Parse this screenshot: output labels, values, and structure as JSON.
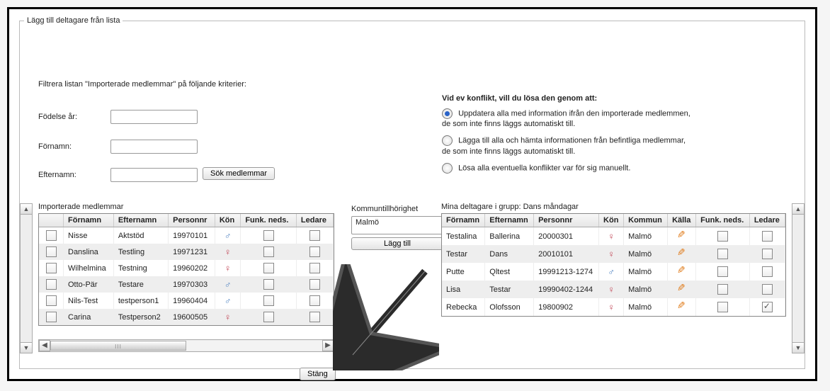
{
  "legend": "Lägg till deltagare från lista",
  "filter": {
    "intro": "Filtrera listan \"Importerade medlemmar\" på följande kriterier:",
    "birth_label": "Födelse år:",
    "first_label": "Förnamn:",
    "last_label": "Efternamn:",
    "birth_value": "",
    "first_value": "",
    "last_value": "",
    "search_btn": "Sök medlemmar"
  },
  "conflict": {
    "heading": "Vid ev konflikt, vill du lösa den genom att:",
    "opt1_a": "Uppdatera alla med information ifrån den importerade medlemmen,",
    "opt1_b": "de som inte finns läggs automatiskt till.",
    "opt2_a": "Lägga till alla och hämta informationen från befintliga medlemmar,",
    "opt2_b": "de som inte finns läggs automatiskt till.",
    "opt3": "Lösa alla eventuella konflikter var för sig manuellt."
  },
  "imported": {
    "title": "Importerade medlemmar",
    "headers": {
      "sel": "",
      "fn": "Förnamn",
      "en": "Efternamn",
      "pn": "Personnr",
      "kon": "Kön",
      "funk": "Funk. neds.",
      "led": "Ledare"
    },
    "rows": [
      {
        "fn": "Nisse",
        "en": "Aktstöd",
        "pn": "19970101",
        "kon": "m"
      },
      {
        "fn": "Danslina",
        "en": "Testling",
        "pn": "19971231",
        "kon": "f"
      },
      {
        "fn": "Wilhelmina",
        "en": "Testning",
        "pn": "19960202",
        "kon": "f"
      },
      {
        "fn": "Otto-Pär",
        "en": "Testare",
        "pn": "19970303",
        "kon": "m"
      },
      {
        "fn": "Nils-Test",
        "en": "testperson1",
        "pn": "19960404",
        "kon": "m"
      },
      {
        "fn": "Carina",
        "en": "Testperson2",
        "pn": "19600505",
        "kon": "f"
      }
    ]
  },
  "mid": {
    "label": "Kommuntillhörighet",
    "selected": "Malmö",
    "add_btn": "Lägg till"
  },
  "group": {
    "title": "Mina deltagare i grupp: Dans måndagar",
    "headers": {
      "fn": "Förnamn",
      "en": "Efternamn",
      "pn": "Personnr",
      "kon": "Kön",
      "kom": "Kommun",
      "kalla": "Källa",
      "funk": "Funk. neds.",
      "led": "Ledare"
    },
    "rows": [
      {
        "fn": "Testalina",
        "en": "Ballerina",
        "pn": "20000301",
        "kon": "f",
        "kom": "Malmö",
        "led": false
      },
      {
        "fn": "Testar",
        "en": "Dans",
        "pn": "20010101",
        "kon": "f",
        "kom": "Malmö",
        "led": false
      },
      {
        "fn": "Putte",
        "en": "Qltest",
        "pn": "19991213-1274",
        "kon": "m",
        "kom": "Malmö",
        "led": false
      },
      {
        "fn": "Lisa",
        "en": "Testar",
        "pn": "19990402-1244",
        "kon": "f",
        "kom": "Malmö",
        "led": false
      },
      {
        "fn": "Rebecka",
        "en": "Olofsson",
        "pn": "19800902",
        "kon": "f",
        "kom": "Malmö",
        "led": true
      }
    ]
  },
  "close_btn": "Stäng"
}
